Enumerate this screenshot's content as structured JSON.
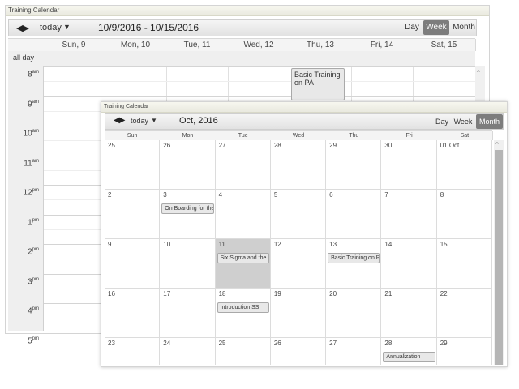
{
  "back_panel": {
    "title": "Training Calendar",
    "toolbar": {
      "today_label": "today",
      "range_title": "10/9/2016 - 10/15/2016",
      "views": [
        "Day",
        "Week",
        "Month"
      ],
      "active_view": "Week"
    },
    "columns": [
      "Sun, 9",
      "Mon, 10",
      "Tue, 11",
      "Wed, 12",
      "Thu, 13",
      "Fri, 14",
      "Sat, 15"
    ],
    "all_day_label": "all day",
    "times": [
      {
        "h": "8",
        "ap": "am"
      },
      {
        "h": "9",
        "ap": "am"
      },
      {
        "h": "10",
        "ap": "am"
      },
      {
        "h": "11",
        "ap": "am"
      },
      {
        "h": "12",
        "ap": "pm"
      },
      {
        "h": "1",
        "ap": "pm"
      },
      {
        "h": "2",
        "ap": "pm"
      },
      {
        "h": "3",
        "ap": "pm"
      },
      {
        "h": "4",
        "ap": "pm"
      },
      {
        "h": "5",
        "ap": "pm"
      }
    ],
    "event": {
      "title": "Basic Training on PA"
    }
  },
  "front_panel": {
    "title": "Training Calendar",
    "toolbar": {
      "today_label": "today",
      "month_title": "Oct, 2016",
      "views": [
        "Day",
        "Week",
        "Month"
      ],
      "active_view": "Month"
    },
    "weekdays": [
      "Sun",
      "Mon",
      "Tue",
      "Wed",
      "Thu",
      "Fri",
      "Sat"
    ],
    "weeks": [
      [
        "25",
        "26",
        "27",
        "28",
        "29",
        "30",
        "01 Oct"
      ],
      [
        "2",
        "3",
        "4",
        "5",
        "6",
        "7",
        "8"
      ],
      [
        "9",
        "10",
        "11",
        "12",
        "13",
        "14",
        "15"
      ],
      [
        "16",
        "17",
        "18",
        "19",
        "20",
        "21",
        "22"
      ],
      [
        "23",
        "24",
        "25",
        "26",
        "27",
        "28",
        "29"
      ]
    ],
    "events": [
      {
        "week": 1,
        "day": 1,
        "title": "On Boarding for the"
      },
      {
        "week": 2,
        "day": 2,
        "title": "Six Sigma and the"
      },
      {
        "week": 2,
        "day": 4,
        "title": "Basic Training on PA"
      },
      {
        "week": 3,
        "day": 2,
        "title": "Introduction SS"
      },
      {
        "week": 4,
        "day": 5,
        "title": "Annualization"
      }
    ]
  }
}
